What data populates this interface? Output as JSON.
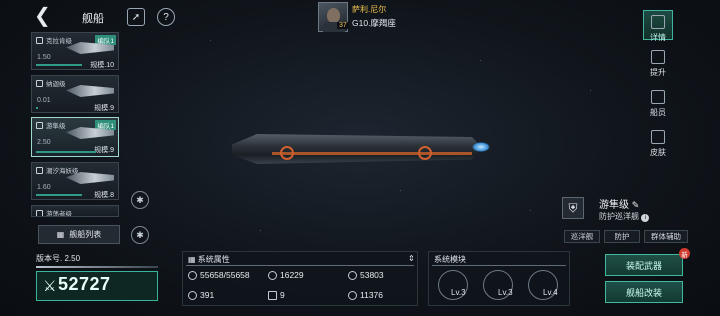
{
  "header": {
    "title": "舰船",
    "back_icon": "back-chevron-icon",
    "rocket_icon": "rocket-icon",
    "help_icon": "help-icon"
  },
  "pilot": {
    "name": "萨利.尼尔",
    "ship": "G10.摩羯座",
    "level": "37"
  },
  "ship_list": [
    {
      "name": "克拉肯级",
      "fleet": "编队1",
      "value": "1.50",
      "scale": "规模.10",
      "selected": false
    },
    {
      "name": "纳迦级",
      "fleet": "",
      "value": "0.01",
      "scale": "规模.9",
      "selected": false
    },
    {
      "name": "游隼级",
      "fleet": "编队1",
      "value": "2.50",
      "scale": "规模.9",
      "selected": true
    },
    {
      "name": "潮汐海妖级",
      "fleet": "",
      "value": "1.60",
      "scale": "规模.8",
      "selected": false
    },
    {
      "name": "游荡者级",
      "fleet": "",
      "value": "",
      "scale": "",
      "selected": false
    }
  ],
  "fleet_list_btn": "舰船列表",
  "version": "版本号. 2.50",
  "power": "52727",
  "right_nav": [
    {
      "label": "详情",
      "active": true
    },
    {
      "label": "提升",
      "active": false
    },
    {
      "label": "船员",
      "active": false
    },
    {
      "label": "皮肤",
      "active": false
    }
  ],
  "ship_class": {
    "name": "游隼级",
    "role": "防护巡洋舰",
    "tags": [
      "巡洋舰",
      "防护",
      "群体辅助"
    ]
  },
  "attributes": {
    "title": "系统属性",
    "items": [
      "55658/55658",
      "16229",
      "53803",
      "391",
      "9",
      "11376"
    ]
  },
  "modules": {
    "title": "系统模块",
    "levels": [
      "Lv.3",
      "Lv.3",
      "Lv.4"
    ]
  },
  "actions": {
    "equip": "装配武器",
    "refit": "舰船改装",
    "badge": "新"
  },
  "colors": {
    "accent": "#3fb39c",
    "gold": "#f3c54d",
    "alert": "#d13b2e"
  }
}
